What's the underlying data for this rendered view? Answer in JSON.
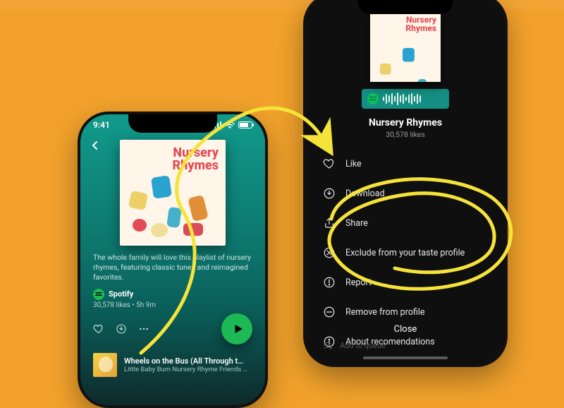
{
  "left": {
    "status_time": "9:41",
    "playlist_title_line1": "Nursery",
    "playlist_title_line2": "Rhymes",
    "description": "The whole family will love this playlist of nursery rhymes, featuring classic tunes and reimagined favorites.",
    "author": "Spotify",
    "meta": "30,578 likes • 5h 9m",
    "track_title": "Wheels on the Bus (All Through t…",
    "track_artist": "Little Baby Bum Nursery Rhyme Friends • …"
  },
  "right": {
    "playlist_title_line1": "Nursery",
    "playlist_title_line2": "Rhymes",
    "menu_title": "Nursery Rhymes",
    "menu_sub": "30,578 likes",
    "items": [
      {
        "label": "Like"
      },
      {
        "label": "Download"
      },
      {
        "label": "Share"
      },
      {
        "label": "Exclude from your taste profile"
      },
      {
        "label": "Report"
      },
      {
        "label": "Remove from profile"
      },
      {
        "label": "About recomendations"
      }
    ],
    "close": "Close",
    "queue_hint": "Add to queue"
  }
}
